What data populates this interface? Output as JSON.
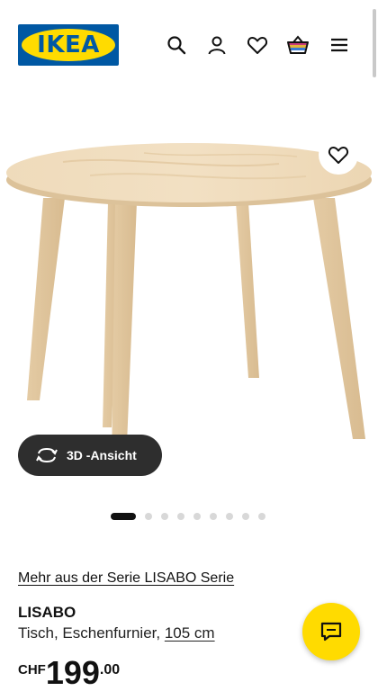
{
  "header": {
    "logo_text": "IKEA",
    "icons": [
      "search-icon",
      "profile-icon",
      "heart-icon",
      "cart-icon",
      "menu-icon"
    ]
  },
  "product_image": {
    "view3d_label": "3D -Ansicht",
    "gallery_dots": 9,
    "active_dot": 1
  },
  "product": {
    "series_link": "Mehr aus der Serie LISABO Serie",
    "name": "LISABO",
    "description": "Tisch, Eschenfurnier,",
    "size": "105 cm",
    "currency": "CHF",
    "price_int": "199",
    "price_dec": ".00"
  },
  "colors": {
    "ikea_blue": "#0058a3",
    "ikea_yellow": "#ffdb00",
    "dark_button": "#2e2e2e"
  }
}
